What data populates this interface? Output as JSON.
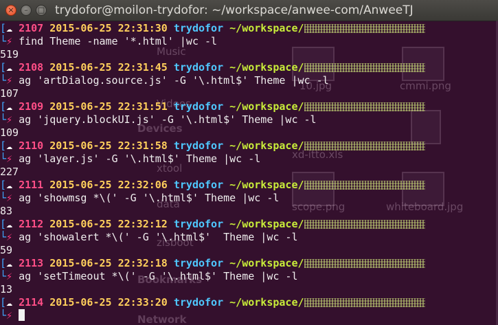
{
  "window": {
    "title": "trydofor@moilon-trydofor: ~/workspace/anwee-com/AnweeTJ",
    "close_glyph": "×",
    "min_glyph": "–",
    "max_glyph": "□"
  },
  "background_ghost": {
    "sidebar_items": [
      "Music",
      "Videos",
      "Devices",
      "xtool",
      "data",
      "zisboot",
      "Bookmarks",
      "Network"
    ],
    "files": [
      "cmmi.png",
      "10.jpg",
      "scope.png",
      "whiteboard.jpg",
      "xd-itto.xls"
    ]
  },
  "prompt_glyphs": {
    "bracket": "[",
    "cloud": "☁",
    "bolt": "⚡"
  },
  "user": "trydofor",
  "path_prefix": "~/workspace/",
  "entries": [
    {
      "num": "2107",
      "date": "2015-06-25",
      "time": "22:31:30",
      "command": "find Theme -name '*.html' |wc -l",
      "output": "519"
    },
    {
      "num": "2108",
      "date": "2015-06-25",
      "time": "22:31:45",
      "command": "ag 'artDialog.source.js' -G '\\.html$' Theme |wc -l",
      "output": "107"
    },
    {
      "num": "2109",
      "date": "2015-06-25",
      "time": "22:31:51",
      "command": "ag 'jquery.blockUI.js' -G '\\.html$' Theme |wc -l",
      "output": "109"
    },
    {
      "num": "2110",
      "date": "2015-06-25",
      "time": "22:31:58",
      "command": "ag 'layer.js' -G '\\.html$' Theme |wc -l",
      "output": "227"
    },
    {
      "num": "2111",
      "date": "2015-06-25",
      "time": "22:32:06",
      "command": "ag 'showmsg *\\(' -G '\\.html$' Theme |wc -l",
      "output": "83"
    },
    {
      "num": "2112",
      "date": "2015-06-25",
      "time": "22:32:12",
      "command": "ag 'showalert *\\(' -G '\\.html$'  Theme |wc -l",
      "output": "59"
    },
    {
      "num": "2113",
      "date": "2015-06-25",
      "time": "22:32:18",
      "command": "ag 'setTimeout *\\(' -G '\\.html$' Theme |wc -l",
      "output": "13"
    }
  ],
  "current": {
    "num": "2114",
    "date": "2015-06-25",
    "time": "22:33:20"
  },
  "colors": {
    "background": "#34102d",
    "bracket": "#3fa9ff",
    "history_number": "#ff4e86",
    "date": "#ffcf5c",
    "user": "#4fc8ff",
    "path": "#c8ec3a"
  }
}
